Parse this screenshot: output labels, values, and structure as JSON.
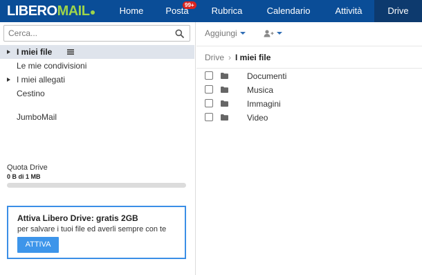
{
  "header": {
    "logo_part1": "LIBERO",
    "logo_part2": "MAIL",
    "nav": [
      "Home",
      "Posta",
      "Rubrica",
      "Calendario",
      "Attività",
      "Drive"
    ],
    "active_nav": "Drive",
    "posta_badge": "99+",
    "colors": {
      "bar": "#0a4d97",
      "active": "#0d3a6e",
      "badge": "#d9231f",
      "logo_accent": "#9ed44a"
    }
  },
  "sidebar": {
    "search_placeholder": "Cerca...",
    "items": [
      {
        "label": "I miei file",
        "selected": true,
        "expandable": true
      },
      {
        "label": "Le mie condivisioni",
        "selected": false,
        "expandable": false
      },
      {
        "label": "I miei allegati",
        "selected": false,
        "expandable": true
      },
      {
        "label": "Cestino",
        "selected": false,
        "expandable": false
      },
      {
        "label": "JumboMail",
        "selected": false,
        "expandable": false
      }
    ],
    "quota_label": "Quota Drive",
    "quota_value": "0 B di 1 MB",
    "quota_used_fraction": 0
  },
  "promo": {
    "title": "Attiva Libero Drive: gratis 2GB",
    "text": "per salvare i tuoi file ed averli sempre con te",
    "button": "ATTIVA"
  },
  "toolbar": {
    "add_label": "Aggiungi",
    "share_icon": "user-plus-icon"
  },
  "breadcrumb": {
    "root": "Drive",
    "current": "I miei file"
  },
  "files": [
    {
      "name": "Documenti",
      "icon": "folder-icon"
    },
    {
      "name": "Musica",
      "icon": "folder-icon"
    },
    {
      "name": "Immagini",
      "icon": "folder-icon"
    },
    {
      "name": "Video",
      "icon": "folder-icon"
    }
  ]
}
